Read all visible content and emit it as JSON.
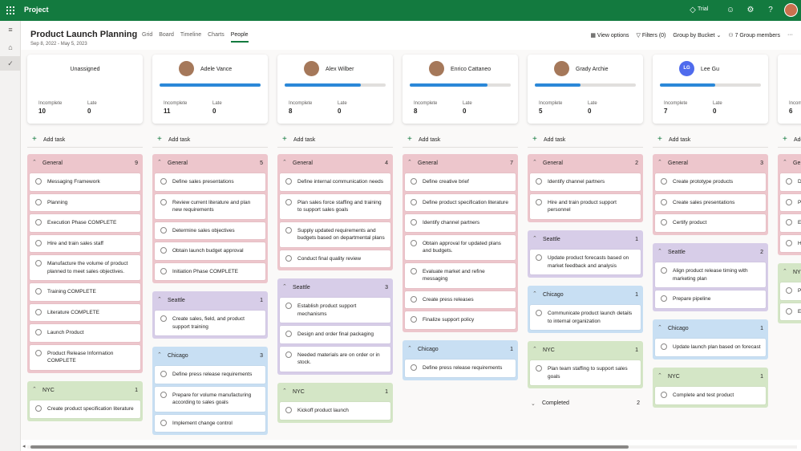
{
  "app": {
    "name": "Project",
    "trial": "Trial"
  },
  "header": {
    "title": "Product Launch Planning",
    "dates": "Sep 8, 2022 - May 5, 2023",
    "tabs": [
      {
        "label": "Grid",
        "active": false
      },
      {
        "label": "Board",
        "active": false
      },
      {
        "label": "Timeline",
        "active": false
      },
      {
        "label": "Charts",
        "active": false
      },
      {
        "label": "People",
        "active": true
      }
    ],
    "view_options": "View options",
    "filters": "Filters (0)",
    "group_by": "Group by Bucket",
    "group_members": "7 Group members"
  },
  "board": {
    "add_task_label": "Add task",
    "incomplete_label": "Incomplete",
    "late_label": "Late",
    "columns": [
      {
        "name": "Unassigned",
        "avatar": "none",
        "progress": 0,
        "incomplete": "10",
        "late": "0",
        "buckets": [
          {
            "name": "General",
            "count": "9",
            "color": "red",
            "tasks": [
              "Messaging Framework",
              "Planning",
              "Execution Phase COMPLETE",
              "Hire and train sales staff",
              "Manufacture the volume of product planned to meet sales objectives.",
              "Training COMPLETE",
              "Literature COMPLETE",
              "Launch Product",
              "Product Release Information COMPLETE"
            ]
          },
          {
            "name": "NYC",
            "count": "1",
            "color": "green",
            "tasks": [
              "Create product specification literature"
            ]
          }
        ]
      },
      {
        "name": "Adele Vance",
        "avatar": "photo",
        "progress": 1.0,
        "incomplete": "11",
        "late": "0",
        "buckets": [
          {
            "name": "General",
            "count": "5",
            "color": "red",
            "tasks": [
              "Define sales presentations",
              "Review current literature and plan new requirements",
              "Determine sales objectives",
              "Obtain launch budget approval",
              "Initiation Phase COMPLETE"
            ]
          },
          {
            "name": "Seattle",
            "count": "1",
            "color": "purple",
            "tasks": [
              "Create sales, field, and product support training"
            ]
          },
          {
            "name": "Chicago",
            "count": "3",
            "color": "blue",
            "tasks": [
              "Define press release requirements",
              "Prepare for volume manufacturing according to sales goals",
              "Implement change control"
            ]
          }
        ]
      },
      {
        "name": "Alex Wilber",
        "avatar": "photo",
        "progress": 0.75,
        "incomplete": "8",
        "late": "0",
        "buckets": [
          {
            "name": "General",
            "count": "4",
            "color": "red",
            "tasks": [
              "Define internal communication needs",
              "Plan sales force staffing and training to support sales goals",
              "Supply updated requirements and budgets based on departmental plans",
              "Conduct final quality review"
            ]
          },
          {
            "name": "Seattle",
            "count": "3",
            "color": "purple",
            "tasks": [
              "Establish product support mechanisms",
              "Design and order final packaging",
              "Needed materials are on order or in stock."
            ]
          },
          {
            "name": "NYC",
            "count": "1",
            "color": "green",
            "tasks": [
              "Kickoff product launch"
            ]
          }
        ]
      },
      {
        "name": "Enrico Cattaneo",
        "avatar": "photo",
        "progress": 0.77,
        "incomplete": "8",
        "late": "0",
        "buckets": [
          {
            "name": "General",
            "count": "7",
            "color": "red",
            "tasks": [
              "Define creative brief",
              "Define product specification literature",
              "Identify channel partners",
              "Obtain approval for updated plans and budgets.",
              "Evaluate market and refine messaging",
              "Create press releases",
              "Finalize support policy"
            ]
          },
          {
            "name": "Chicago",
            "count": "1",
            "color": "blue",
            "tasks": [
              "Define press release requirements"
            ]
          }
        ]
      },
      {
        "name": "Grady Archie",
        "avatar": "photo",
        "progress": 0.45,
        "incomplete": "5",
        "late": "0",
        "buckets": [
          {
            "name": "General",
            "count": "2",
            "color": "red",
            "tasks": [
              "Identify channel partners",
              "Hire and train product support personnel"
            ]
          },
          {
            "name": "Seattle",
            "count": "1",
            "color": "purple",
            "tasks": [
              "Update product forecasts based on market feedback and analysis"
            ]
          },
          {
            "name": "Chicago",
            "count": "1",
            "color": "blue",
            "tasks": [
              "Communicate product launch details to internal organization"
            ]
          },
          {
            "name": "NYC",
            "count": "1",
            "color": "green",
            "tasks": [
              "Plan team staffing to support sales goals"
            ]
          }
        ],
        "completed": {
          "label": "Completed",
          "count": "2"
        }
      },
      {
        "name": "Lee Gu",
        "avatar": "LG",
        "progress": 0.55,
        "incomplete": "7",
        "late": "0",
        "buckets": [
          {
            "name": "General",
            "count": "3",
            "color": "red",
            "tasks": [
              "Create prototype products",
              "Create sales presentations",
              "Certify product"
            ]
          },
          {
            "name": "Seattle",
            "count": "2",
            "color": "purple",
            "tasks": [
              "Align product release timing with marketing plan",
              "Prepare pipeline"
            ]
          },
          {
            "name": "Chicago",
            "count": "1",
            "color": "blue",
            "tasks": [
              "Update launch plan based on forecast"
            ]
          },
          {
            "name": "NYC",
            "count": "1",
            "color": "green",
            "tasks": [
              "Complete and test product"
            ]
          }
        ]
      },
      {
        "name": "",
        "avatar": "none",
        "progress": 0,
        "incomplete": "6",
        "late": "",
        "buckets": [
          {
            "name": "Ge",
            "count": "",
            "color": "red",
            "tasks": [
              "D",
              "P",
              "E",
              "H"
            ]
          },
          {
            "name": "NYC",
            "count": "",
            "color": "green",
            "tasks": [
              "P",
              "E"
            ]
          }
        ]
      }
    ]
  },
  "colors": {
    "brand": "#137a3f",
    "progress": "#2b88d8",
    "red": "#edc6cc",
    "purple": "#d7cde8",
    "blue": "#c8dff3",
    "green": "#d4e6c6"
  }
}
